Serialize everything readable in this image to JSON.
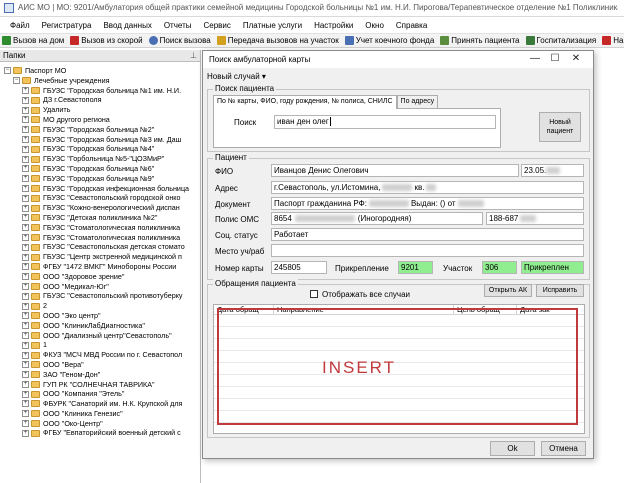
{
  "app": {
    "title": "АИС МО | МО: 9201/Амбулатория общей практики семейной медицины Городской больницы №1 им. Н.И. Пирогова/Терапевтическое отделение №1 Поликлиника №1/Заместитель"
  },
  "menu": [
    "Файл",
    "Регистратура",
    "Ввод данных",
    "Отчеты",
    "Сервис",
    "Платные услуги",
    "Настройки",
    "Окно",
    "Справка"
  ],
  "toolbar": {
    "items": [
      {
        "label": "Вызов на дом",
        "icon": "check-icon",
        "color": "#2e8b2e"
      },
      {
        "label": "Вызов из скорой",
        "icon": "ambulance-icon",
        "color": "#c62828"
      },
      {
        "label": "Поиск вызова",
        "icon": "search-icon",
        "color": "#4a6fb5"
      },
      {
        "label": "Передача вызовов на участок",
        "icon": "transfer-icon",
        "color": "#d4a020"
      },
      {
        "label": "Учет коечного фонда",
        "icon": "bed-icon",
        "color": "#4a6fb5"
      },
      {
        "label": "Принять пациента",
        "icon": "accept-icon",
        "color": "#5b8d3e"
      },
      {
        "label": "Госпитализация",
        "icon": "hospital-icon",
        "color": "#3a7a3a"
      },
      {
        "label": "Направление на М",
        "icon": "referral-icon",
        "color": "#c62828"
      }
    ]
  },
  "left_pane": {
    "header": "Папки",
    "pin": "⊥",
    "tree": [
      {
        "level": 0,
        "toggle": "−",
        "label": "Паспорт МО"
      },
      {
        "level": 1,
        "toggle": "−",
        "label": "Лечебные учреждения"
      },
      {
        "level": 2,
        "toggle": "+",
        "label": "ГБУЗС \"Городская больница №1 им. Н.И."
      },
      {
        "level": 2,
        "toggle": "+",
        "label": "ДЗ г.Севастополя"
      },
      {
        "level": 2,
        "toggle": "+",
        "label": "Удалить"
      },
      {
        "level": 2,
        "toggle": "+",
        "label": "МО другого региона"
      },
      {
        "level": 2,
        "toggle": "+",
        "label": "ГБУЗС \"Городская больница №2\""
      },
      {
        "level": 2,
        "toggle": "+",
        "label": "ГБУЗС \"Городская больница №3 им. Даш"
      },
      {
        "level": 2,
        "toggle": "+",
        "label": "ГБУЗС \"Городская больница №4\""
      },
      {
        "level": 2,
        "toggle": "+",
        "label": "ГБУЗС \"Горбольница №5-\"ЦОЗМиР\""
      },
      {
        "level": 2,
        "toggle": "+",
        "label": "ГБУЗС \"Городская больница №6\""
      },
      {
        "level": 2,
        "toggle": "+",
        "label": "ГБУЗС \"Городская больница №9\""
      },
      {
        "level": 2,
        "toggle": "+",
        "label": "ГБУЗС \"Городская инфекционная больница"
      },
      {
        "level": 2,
        "toggle": "+",
        "label": "ГБУЗС \"Севастопольский городской онко"
      },
      {
        "level": 2,
        "toggle": "+",
        "label": "ГБУЗС \"Кожно-венерологический диспан"
      },
      {
        "level": 2,
        "toggle": "+",
        "label": "ГБУЗС \"Детская поликлиника №2\""
      },
      {
        "level": 2,
        "toggle": "+",
        "label": "ГБУЗС \"Стоматологическая поликлиника"
      },
      {
        "level": 2,
        "toggle": "+",
        "label": "ГБУЗС \"Стоматологическая поликлиника"
      },
      {
        "level": 2,
        "toggle": "+",
        "label": "ГБУЗС \"Севастопольская детская стомато"
      },
      {
        "level": 2,
        "toggle": "+",
        "label": "ГБУЗС \"Центр экстренной медицинской п"
      },
      {
        "level": 2,
        "toggle": "+",
        "label": "ФГБУ \"1472 ВМКГ\" Минобороны России"
      },
      {
        "level": 2,
        "toggle": "+",
        "label": "ООО \"Здоровое зрение\""
      },
      {
        "level": 2,
        "toggle": "+",
        "label": "ООО \"Медикал-Юг\""
      },
      {
        "level": 2,
        "toggle": "+",
        "label": "ГБУЗС \"Севастопольский противотуберку"
      },
      {
        "level": 2,
        "toggle": "+",
        "label": "2"
      },
      {
        "level": 2,
        "toggle": "+",
        "label": "ООО \"Эко центр\""
      },
      {
        "level": 2,
        "toggle": "+",
        "label": "ООО \"КлиникЛабДиагностика\""
      },
      {
        "level": 2,
        "toggle": "+",
        "label": "ООО \"Диализный центр\"Севастополь\""
      },
      {
        "level": 2,
        "toggle": "+",
        "label": "1"
      },
      {
        "level": 2,
        "toggle": "+",
        "label": "ФКУЗ \"МСЧ МВД России по г. Севастопол"
      },
      {
        "level": 2,
        "toggle": "+",
        "label": "ООО \"Вера\""
      },
      {
        "level": 2,
        "toggle": "+",
        "label": "ЗАО \"Геном-Дон\""
      },
      {
        "level": 2,
        "toggle": "+",
        "label": "ГУП РК \"СОЛНЕЧНАЯ ТАВРИКА\""
      },
      {
        "level": 2,
        "toggle": "+",
        "label": "ООО \"Компания \"Этель\""
      },
      {
        "level": 2,
        "toggle": "+",
        "label": "ФБУРК \"Санаторий им. Н.К. Крупской для"
      },
      {
        "level": 2,
        "toggle": "+",
        "label": "ООО \"Клиника Генезис\""
      },
      {
        "level": 2,
        "toggle": "+",
        "label": "ООО \"Око-Центр\""
      },
      {
        "level": 2,
        "toggle": "+",
        "label": "ФГБУ \"Евпаторийский военный детский с"
      }
    ]
  },
  "dialog": {
    "title": "Поиск амбулаторной карты",
    "minimize": "—",
    "maximize": "☐",
    "close": "✕",
    "menu": "Новый случай ▾",
    "search_group": "Поиск пациента",
    "tabs": [
      "По № карты, ФИО, году рождения, № полиса, СНИЛС",
      "По адресу"
    ],
    "search_label": "Поиск",
    "search_value": "иван ден олег",
    "new_patient_button": "Новый\nпациент",
    "patient_group": "Пациент",
    "fields": {
      "fio_label": "ФИО",
      "fio_value": "Иванцов Денис Олегович",
      "birth_value": "23.05.",
      "address_label": "Адрес",
      "address_value": "г.Севастополь, ул.Истомина,",
      "address_suffix": "кв.",
      "document_label": "Документ",
      "document_value": "Паспорт гражданина РФ:",
      "document_issued": "Выдан: () от",
      "polis_label": "Полис ОМС",
      "polis_value": "8654",
      "polis_note": "(Иногородняя)",
      "snils_value": "188-687",
      "soc_label": "Соц. статус",
      "soc_value": "Работает",
      "work_label": "Место уч/раб",
      "card_label": "Номер карты",
      "card_value": "245805",
      "attach_label": "Прикрепление",
      "attach_value": "9201",
      "uchastok_label": "Участок",
      "uchastok_value": "306",
      "attach_status": "Прикреплен"
    },
    "appeals_group": "Обращения пациента",
    "show_all_label": "Отображать все случаи",
    "open_ak_button": "Открыть АК",
    "fix_button": "Исправить",
    "grid_columns": [
      "Дата обращ",
      "Направление",
      "Цель обращ",
      "Дата зак"
    ],
    "insert_text": "INSERT",
    "ok_button": "Ok",
    "cancel_button": "Отмена",
    "insert_color": "#c0393b"
  }
}
